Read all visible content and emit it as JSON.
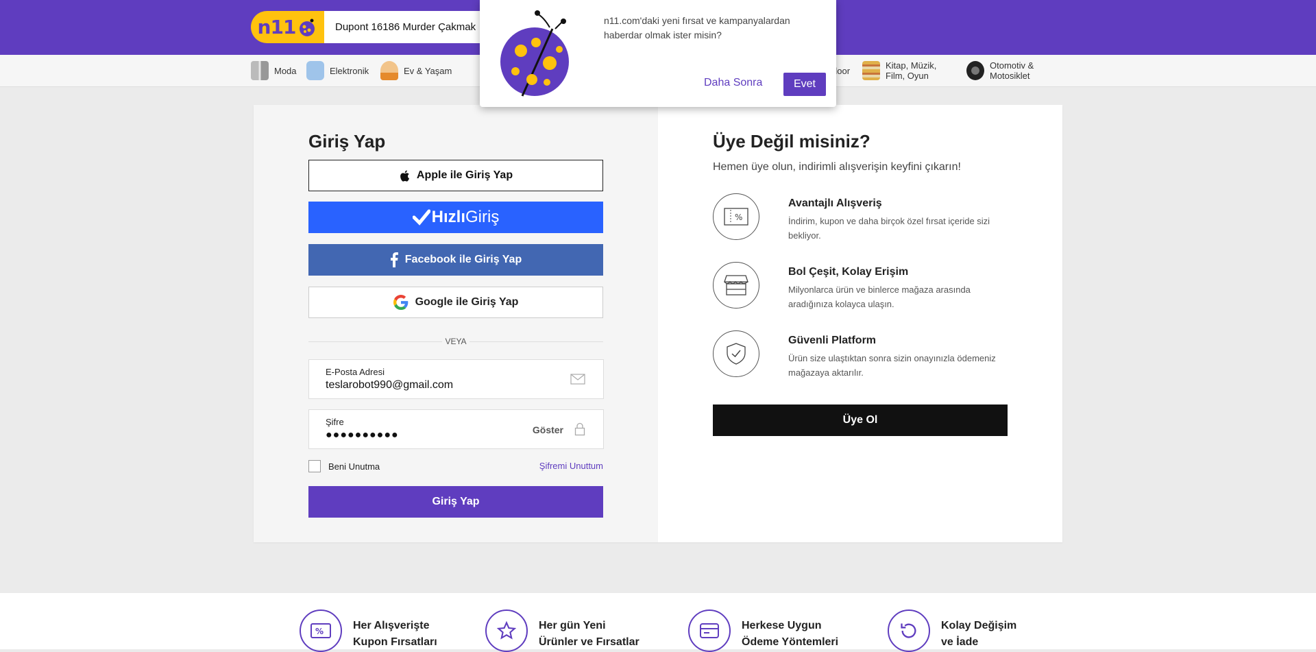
{
  "header": {
    "logo_text": "n11",
    "search_value": "Dupont 16186 Murder Çakmak",
    "brand_color": "#5f3dbf",
    "logo_color": "#ffc20e"
  },
  "categories": [
    {
      "label": "Moda",
      "icon": "fashion-icon"
    },
    {
      "label": "Elektronik",
      "icon": "electronics-icon"
    },
    {
      "label": "Ev & Yaşam",
      "icon": "home-icon"
    },
    {
      "label": "door",
      "icon": "outdoor-icon"
    },
    {
      "label": "Kitap, Müzik, Film, Oyun",
      "icon": "book-icon"
    },
    {
      "label": "Otomotiv & Motosiklet",
      "icon": "tire-icon"
    }
  ],
  "login": {
    "title": "Giriş Yap",
    "apple_label": "Apple ile Giriş Yap",
    "hizli_bold": "Hızlı",
    "hizli_light": "Giriş",
    "facebook_label": "Facebook ile Giriş Yap",
    "google_label": "Google ile Giriş Yap",
    "divider": "VEYA",
    "email_label": "E-Posta Adresi",
    "email_value": "teslarobot990@gmail.com",
    "password_label": "Şifre",
    "password_value": "●●●●●●●●●●",
    "show_label": "Göster",
    "remember_label": "Beni Unutma",
    "forgot_label": "Şifremi Unuttum",
    "submit_label": "Giriş Yap"
  },
  "register": {
    "title": "Üye Değil misiniz?",
    "subtitle": "Hemen üye olun, indirimli alışverişin keyfini çıkarın!",
    "features": [
      {
        "title": "Avantajlı Alışveriş",
        "desc": "İndirim, kupon ve daha birçok özel fırsat içeride sizi bekliyor.",
        "icon": "coupon-icon"
      },
      {
        "title": "Bol Çeşit, Kolay Erişim",
        "desc": "Milyonlarca ürün ve binlerce mağaza arasında aradığınıza kolayca ulaşın.",
        "icon": "store-icon"
      },
      {
        "title": "Güvenli Platform",
        "desc": "Ürün size ulaştıktan sonra sizin onayınızla ödemeniz mağazaya aktarılır.",
        "icon": "shield-icon"
      }
    ],
    "button_label": "Üye Ol"
  },
  "footer": [
    {
      "line1": "Her Alışverişte",
      "line2": "Kupon Fırsatları",
      "icon": "coupon-icon"
    },
    {
      "line1": "Her gün Yeni",
      "line2": "Ürünler ve Fırsatlar",
      "icon": "star-icon"
    },
    {
      "line1": "Herkese Uygun",
      "line2": "Ödeme Yöntemleri",
      "icon": "card-icon"
    },
    {
      "line1": "Kolay Değişim",
      "line2": "ve İade",
      "icon": "return-icon"
    }
  ],
  "popup": {
    "message": "n11.com'daki yeni fırsat ve kampanyalardan haberdar olmak ister misin?",
    "later_label": "Daha Sonra",
    "yes_label": "Evet"
  }
}
